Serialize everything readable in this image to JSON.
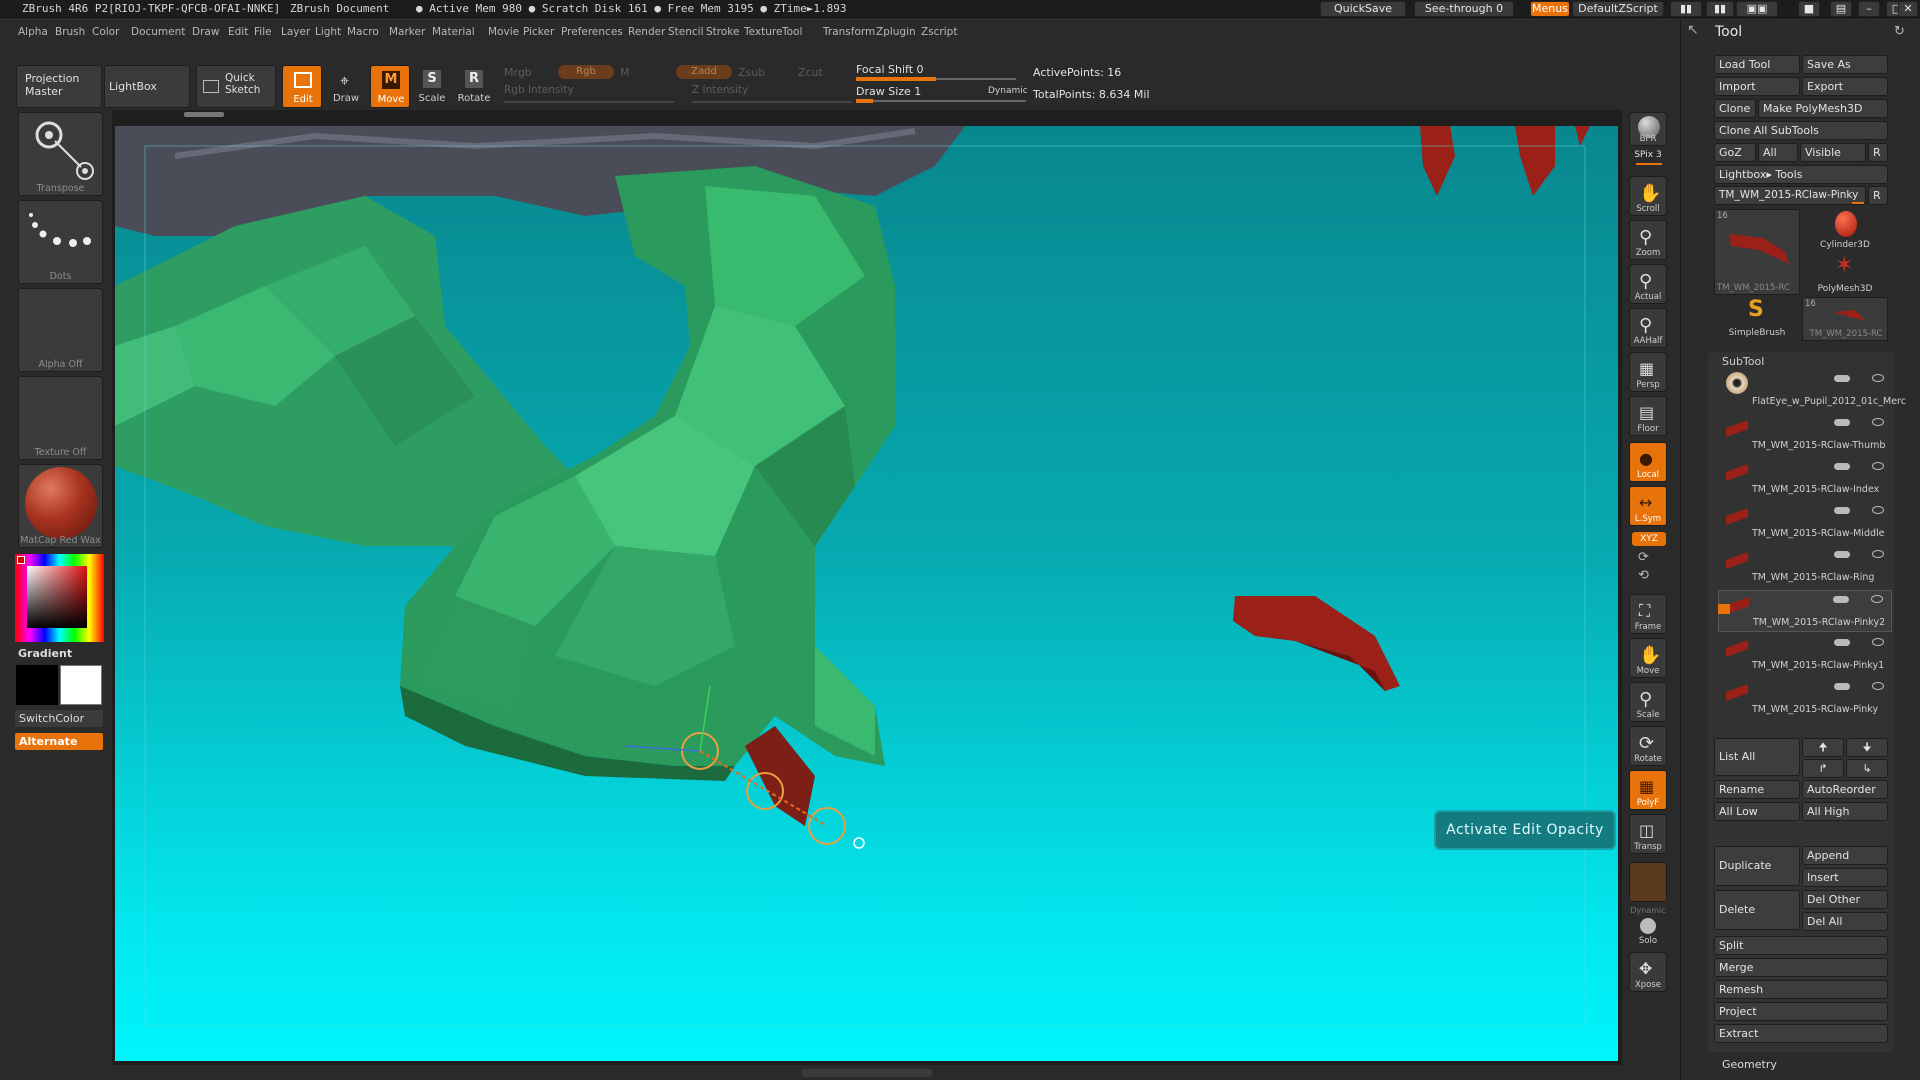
{
  "title_bar": {
    "app_title": "ZBrush 4R6 P2[RIOJ-TKPF-QFCB-OFAI-NNKE]",
    "document": "ZBrush Document",
    "stats": "● Active Mem 980 ● Scratch Disk 161 ● Free Mem 3195 ● ZTime►1.893",
    "quicksave": "QuickSave",
    "see_through": "See-through  0",
    "menus": "Menus",
    "zscript": "DefaultZScript"
  },
  "menubar": [
    "Alpha",
    "Brush",
    "Color",
    "Document",
    "Draw",
    "Edit",
    "File",
    "Layer",
    "Light",
    "Macro",
    "Marker",
    "Material",
    "Movie",
    "Picker",
    "Preferences",
    "Render",
    "Stencil",
    "Stroke",
    "Texture",
    "Tool",
    "Transform",
    "Zplugin",
    "Zscript"
  ],
  "toolbar": {
    "projection_master": "Projection Master",
    "lightbox": "LightBox",
    "quick_sketch": "Quick Sketch",
    "edit": "Edit",
    "draw": "Draw",
    "move": "Move",
    "scale": "Scale",
    "rotate": "Rotate",
    "mrgb": "Mrgb",
    "rgb": "Rgb",
    "m": "M",
    "zadd": "Zadd",
    "zsub": "Zsub",
    "zcut": "Zcut",
    "rgb_intensity": "Rgb Intensity",
    "z_intensity": "Z Intensity",
    "focal_shift": "Focal Shift 0",
    "draw_size": "Draw Size 1",
    "dynamic": "Dynamic",
    "active_points": "ActivePoints: 16",
    "total_points": "TotalPoints: 8.634 Mil",
    "focal_shift_level": 0.5,
    "draw_size_level": 0.1
  },
  "left_shelf": {
    "transpose": "Transpose",
    "dots": "Dots",
    "alpha_off": "Alpha  Off",
    "texture_off": "Texture  Off",
    "material": "MatCap Red Wax",
    "gradient": "Gradient",
    "switch_color": "SwitchColor",
    "alternate": "Alternate"
  },
  "right_shelf": {
    "bpr": "BPR",
    "spix": "SPix 3",
    "scroll": "Scroll",
    "zoom": "Zoom",
    "actual": "Actual",
    "aahalf": "AAHalf",
    "persp": "Persp",
    "floor": "Floor",
    "local": "Local",
    "lsym": "L.Sym",
    "xyz": "XYZ",
    "frame": "Frame",
    "move": "Move",
    "scale": "Scale",
    "rotate": "Rotate",
    "polyf": "PolyF",
    "transp": "Transp",
    "dynamic": "Dynamic",
    "solo": "Solo",
    "xpose": "Xpose"
  },
  "tooltip": "Activate Edit Opacity",
  "tool_palette": {
    "title": "Tool",
    "load_tool": "Load Tool",
    "save_as": "Save As",
    "import": "Import",
    "export": "Export",
    "clone": "Clone",
    "make_polymesh": "Make PolyMesh3D",
    "clone_all": "Clone  All  SubTools",
    "goz": "GoZ",
    "all": "All",
    "visible": "Visible",
    "r": "R",
    "lightbox_tools": "Lightbox▸ Tools",
    "current_tool": "TM_WM_2015-RClaw-Pinky",
    "thumb_count_1": "16",
    "thumb_count_2": "16",
    "thumbs": {
      "t1": "TM_WM_2015-RC",
      "t2": "Cylinder3D",
      "t3": "PolyMesh3D",
      "t4": "SimpleBrush",
      "t5": "TM_WM_2015-RC"
    }
  },
  "subtool": {
    "header": "SubTool",
    "items": [
      "FlatEye_w_Pupil_2012_01c_Merc",
      "TM_WM_2015-RClaw-Thumb",
      "TM_WM_2015-RClaw-Index",
      "TM_WM_2015-RClaw-Middle",
      "TM_WM_2015-RClaw-Ring",
      "TM_WM_2015-RClaw-Pinky2",
      "TM_WM_2015-RClaw-Pinky1",
      "TM_WM_2015-RClaw-Pinky"
    ],
    "list_all": "List  All",
    "rename": "Rename",
    "autoreorder": "AutoReorder",
    "all_low": "All Low",
    "all_high": "All High",
    "duplicate": "Duplicate",
    "append": "Append",
    "insert": "Insert",
    "delete": "Delete",
    "del_other": "Del Other",
    "del_all": "Del All",
    "split": "Split",
    "merge": "Merge",
    "remesh": "Remesh",
    "project": "Project",
    "extract": "Extract",
    "geometry": "Geometry"
  },
  "colors": {
    "accent": "#e8730a",
    "viewport_top": "#08878e",
    "viewport_bottom": "#00f5fd",
    "mesh_green": "#2fa86a",
    "claw_red": "#9b2018"
  }
}
